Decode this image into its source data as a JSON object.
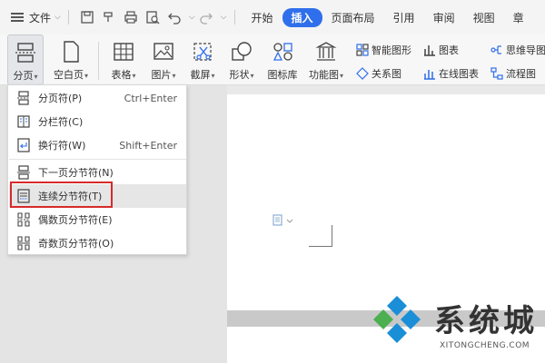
{
  "menubar": {
    "file_label": "文件",
    "tabs": [
      "开始",
      "插入",
      "页面布局",
      "引用",
      "审阅",
      "视图",
      "章"
    ],
    "active_tab": "插入"
  },
  "ribbon": {
    "page_break_label": "分页",
    "blank_page_label": "空白页",
    "table_label": "表格",
    "image_label": "图片",
    "screenshot_label": "截屏",
    "shape_label": "形状",
    "icon_library_label": "图标库",
    "function_chart_label": "功能图",
    "smart_graphic_label": "智能图形",
    "chart_label": "图表",
    "mind_map_label": "思维导图",
    "relation_label": "关系图",
    "online_chart_label": "在线图表",
    "flowchart_label": "流程图"
  },
  "dropdown": {
    "items": [
      {
        "label": "分页符(P)",
        "shortcut": "Ctrl+Enter"
      },
      {
        "label": "分栏符(C)",
        "shortcut": ""
      },
      {
        "label": "换行符(W)",
        "shortcut": "Shift+Enter"
      },
      {
        "label": "下一页分节符(N)",
        "shortcut": ""
      },
      {
        "label": "连续分节符(T)",
        "shortcut": ""
      },
      {
        "label": "偶数页分节符(E)",
        "shortcut": ""
      },
      {
        "label": "奇数页分节符(O)",
        "shortcut": ""
      }
    ],
    "highlighted_item": "连续分节符(T)"
  },
  "watermark": {
    "title": "系统城",
    "subtitle": "XITONGCHENG.COM"
  },
  "colors": {
    "accent": "#2f6fec",
    "highlight_box": "#d62a2a",
    "logo_blue": "#1a8fd8",
    "logo_green": "#4caf50"
  }
}
